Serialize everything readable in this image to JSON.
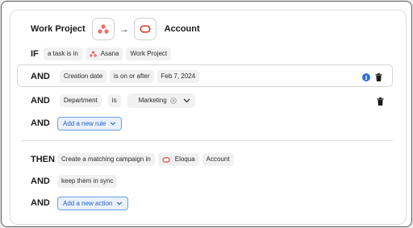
{
  "header": {
    "source_title": "Work Project",
    "target_title": "Account",
    "source_icon": "asana-icon",
    "target_icon": "eloqua-icon",
    "arrow": "→"
  },
  "if_row": {
    "keyword": "IF",
    "trigger": "a task is in",
    "app": "Asana",
    "project": "Work Project"
  },
  "rules": [
    {
      "keyword": "AND",
      "field": "Creation date",
      "operator": "is on or after",
      "value": "Feb 7, 2024"
    },
    {
      "keyword": "AND",
      "field": "Department",
      "operator": "is",
      "value": "Marketing"
    }
  ],
  "add_rule": {
    "keyword": "AND",
    "label": "Add a new rule"
  },
  "then_row": {
    "keyword": "THEN",
    "action": "Create a matching campaign in",
    "app": "Eloqua",
    "object": "Account"
  },
  "sync_row": {
    "keyword": "AND",
    "label": "keep them in sync"
  },
  "add_action": {
    "keyword": "AND",
    "label": "Add a new action"
  },
  "colors": {
    "asana": "#f06a6a",
    "eloqua": "#e0402f",
    "link_blue": "#1f5fbf",
    "info_blue": "#2f6fd6"
  }
}
